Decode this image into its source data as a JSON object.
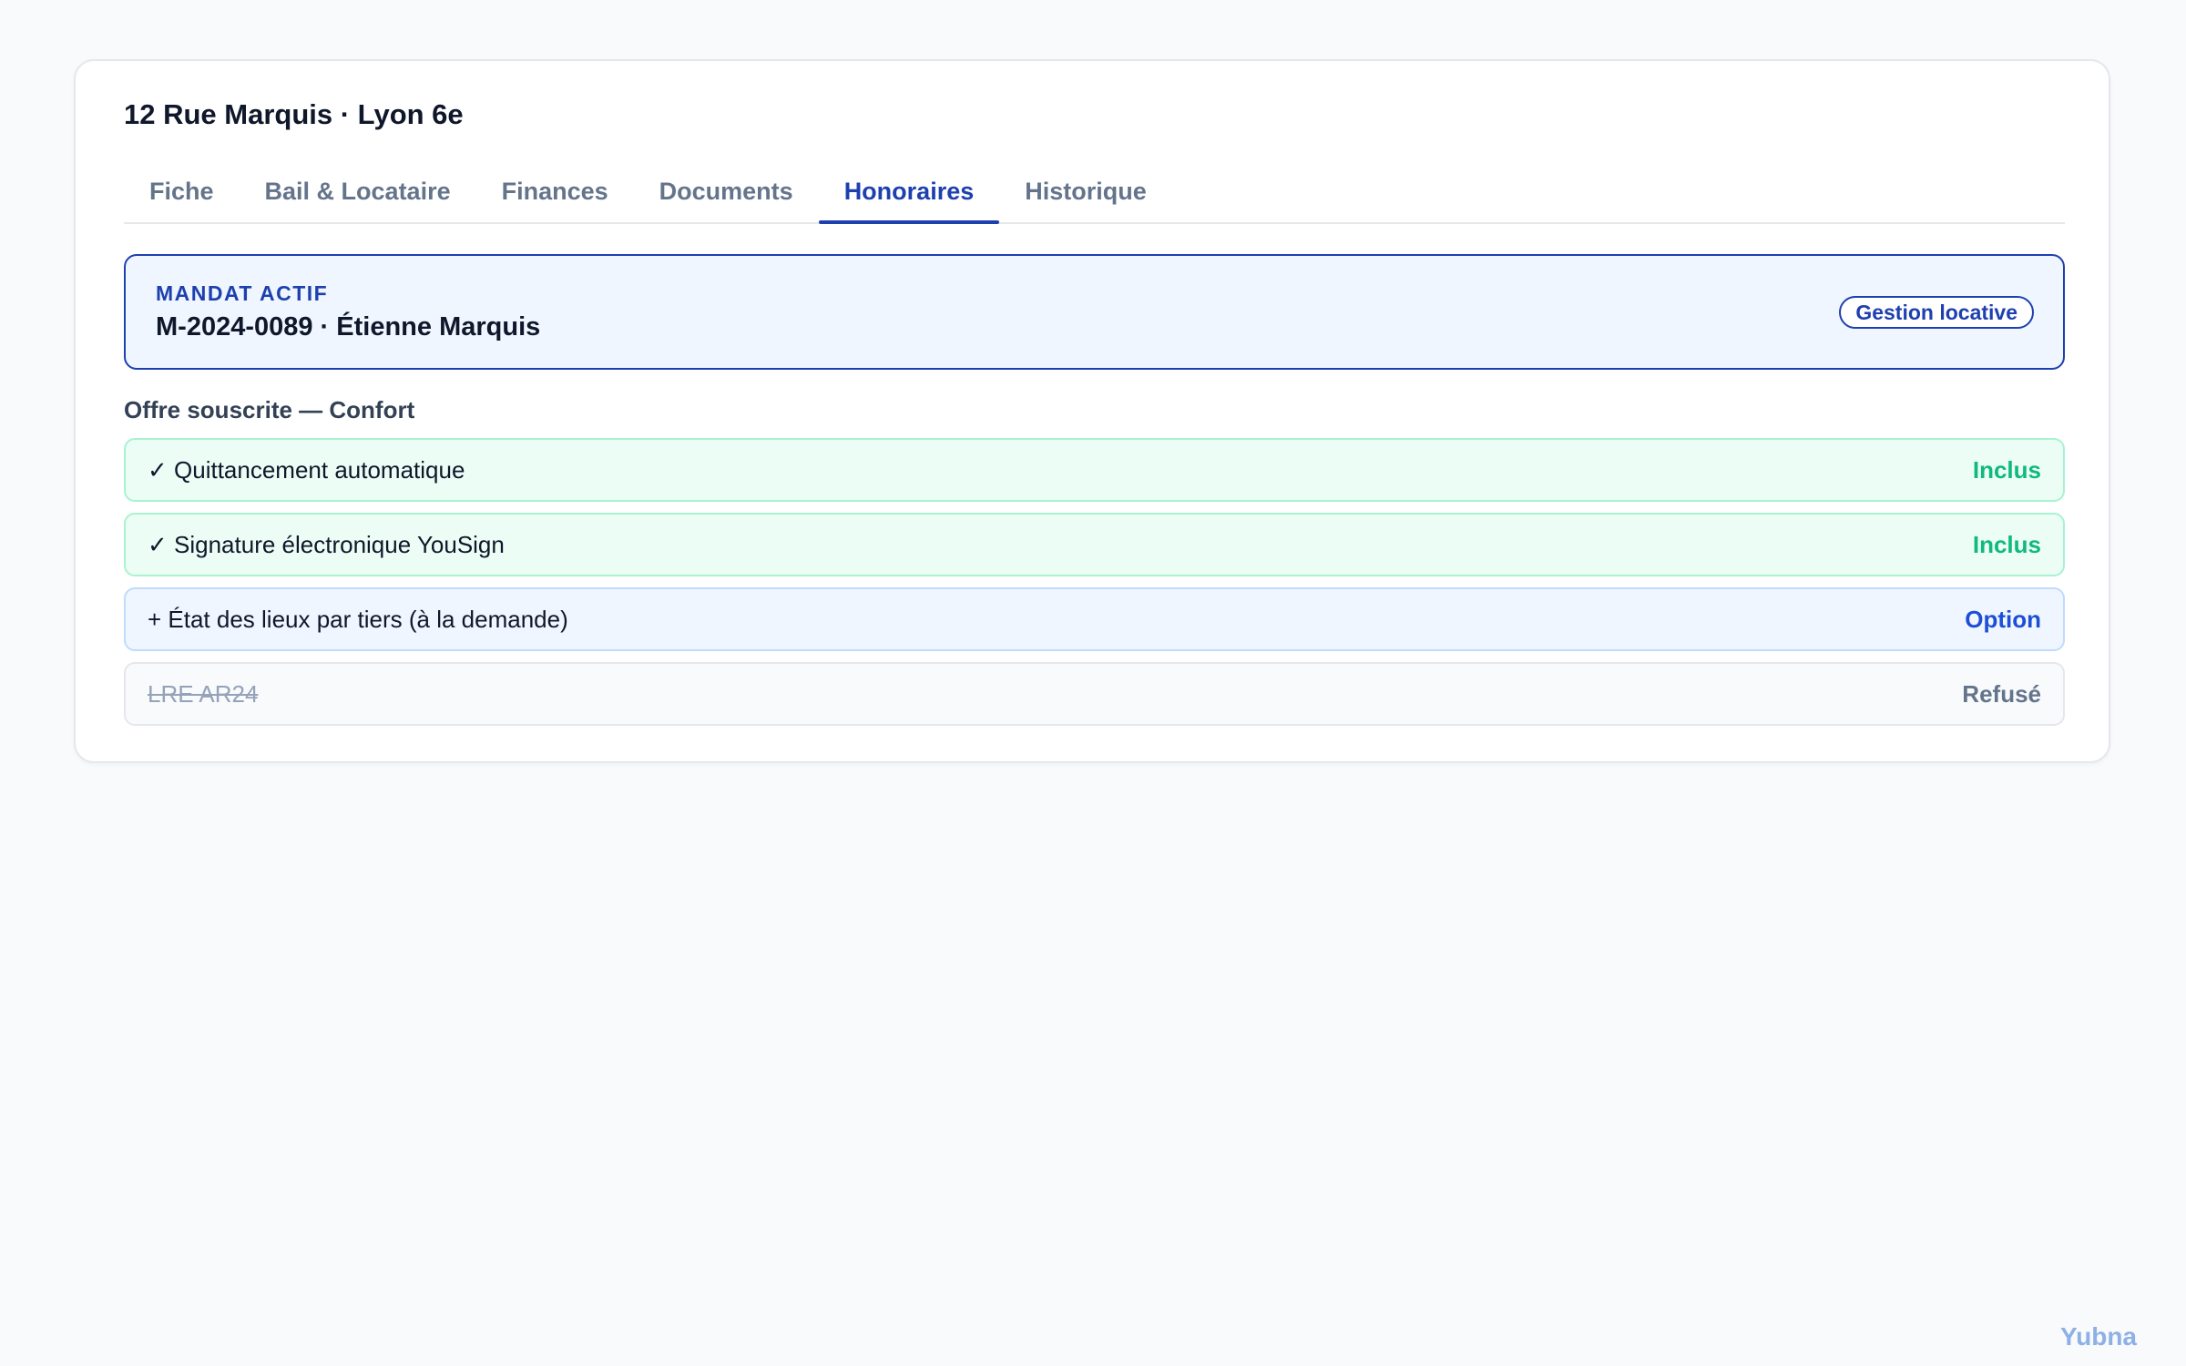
{
  "property": {
    "title": "12 Rue Marquis · Lyon 6e"
  },
  "tabs": [
    {
      "label": "Fiche",
      "active": false
    },
    {
      "label": "Bail & Locataire",
      "active": false
    },
    {
      "label": "Finances",
      "active": false
    },
    {
      "label": "Documents",
      "active": false
    },
    {
      "label": "Honoraires",
      "active": true
    },
    {
      "label": "Historique",
      "active": false
    }
  ],
  "mandat": {
    "label": "MANDAT ACTIF",
    "reference": "M-2024-0089 · Étienne Marquis",
    "type_badge": "Gestion locative"
  },
  "offer": {
    "title": "Offre souscrite — Confort",
    "items": [
      {
        "label": "✓ Quittancement automatique",
        "status": "Inclus",
        "state": "included"
      },
      {
        "label": "✓ Signature électronique YouSign",
        "status": "Inclus",
        "state": "included"
      },
      {
        "label": "+ État des lieux par tiers (à la demande)",
        "status": "Option",
        "state": "option"
      },
      {
        "label": "LRE AR24",
        "status": "Refusé",
        "state": "refused"
      }
    ]
  },
  "brand": {
    "name": "Yubna"
  },
  "colors": {
    "accent": "#1e40af",
    "included": "#10b981",
    "background": "#f8fafc"
  }
}
